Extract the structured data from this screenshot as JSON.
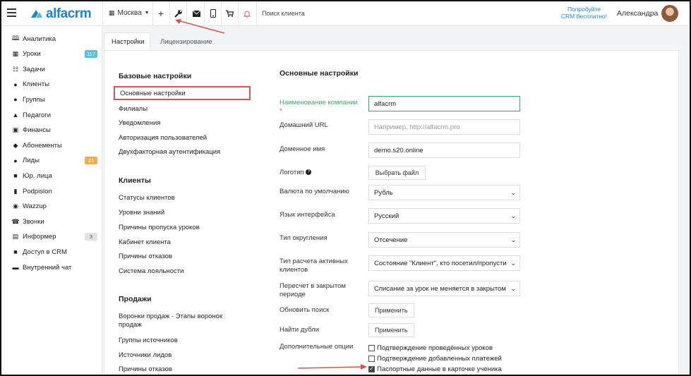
{
  "topbar": {
    "logo_text": "alfacrm",
    "city": "Москва",
    "search_placeholder": "Поиск клиента",
    "promo_line1": "Попробуйте",
    "promo_line2": "CRM бесплатно!",
    "user_name": "Александра",
    "icons": [
      "menu-icon",
      "chevron-down-icon",
      "plus-icon",
      "wrench-icon",
      "mail-icon",
      "phone-icon",
      "cart-icon",
      "bell-icon"
    ]
  },
  "sidebar": {
    "items": [
      {
        "label": "Аналитика",
        "icon": "book-icon"
      },
      {
        "label": "Уроки",
        "icon": "calendar-icon",
        "badge": "117",
        "badge_color": "#5bc0de"
      },
      {
        "label": "Задачи",
        "icon": "clipboard-icon"
      },
      {
        "label": "Клиенты",
        "icon": "user-icon"
      },
      {
        "label": "Группы",
        "icon": "users-icon"
      },
      {
        "label": "Педагоги",
        "icon": "graduation-cap-icon"
      },
      {
        "label": "Финансы",
        "icon": "money-icon"
      },
      {
        "label": "Абонементы",
        "icon": "ticket-icon"
      },
      {
        "label": "Лиды",
        "icon": "user-plus-icon",
        "badge": "21",
        "badge_color": "#f0ad4e"
      },
      {
        "label": "Юр. лица",
        "icon": "briefcase-icon"
      },
      {
        "label": "Podpislon",
        "icon": "document-icon"
      },
      {
        "label": "Wazzup",
        "icon": "whatsapp-icon"
      },
      {
        "label": "Звонки",
        "icon": "phone-icon"
      },
      {
        "label": "Информер",
        "icon": "server-icon",
        "badge": "3",
        "badge_color": "#dfe3e6"
      },
      {
        "label": "Доступ в CRM",
        "icon": "lock-icon"
      },
      {
        "label": "Внутренний чат",
        "icon": "chat-icon"
      }
    ]
  },
  "tabs": [
    {
      "label": "Настройки",
      "active": true
    },
    {
      "label": "Лицензирование",
      "active": false
    }
  ],
  "settings_nav": {
    "sections": [
      {
        "heading": "Базовые настройки",
        "links": [
          "Основные настройки",
          "Филиалы",
          "Уведомления",
          "Авторизация пользователей",
          "Двухфакторная аутентификация"
        ]
      },
      {
        "heading": "Клиенты",
        "links": [
          "Статусы клиентов",
          "Уровни знаний",
          "Причины пропуска уроков",
          "Кабинет клиента",
          "Причины отказов",
          "Система лояльности"
        ]
      },
      {
        "heading": "Продажи",
        "links": [
          "Воронки продаж - Этапы воронок продаж",
          "Группы источников",
          "Источники лидов",
          "Причины отказов"
        ]
      }
    ]
  },
  "form": {
    "title": "Основные настройки",
    "company_label": "Наименование компании",
    "company_value": "alfacrm",
    "home_url_label": "Домашний URL",
    "home_url_placeholder": "Например, http://alfacrm.pro",
    "domain_label": "Доменное имя",
    "domain_value": "demo.s20.online",
    "logo_label": "Логотип",
    "logo_button": "Выбрать файл",
    "currency_label": "Валюта по умолчанию",
    "currency_value": "Рубль",
    "language_label": "Язык интерфейса",
    "language_value": "Русский",
    "rounding_label": "Тип округления",
    "rounding_value": "Отсечение",
    "active_calc_label": "Тип расчета активных клиентов",
    "active_calc_value": "Состояние \"Клиент\", кто посетил/пропусти",
    "recalc_label": "Пересчет в закрытом периоде",
    "recalc_value": "Списание за урок не меняется в закрытом",
    "refresh_search_label": "Обновить поиск",
    "refresh_search_button": "Применить",
    "find_dupes_label": "Найти дубли",
    "find_dupes_button": "Применить",
    "extra_options_label": "Дополнительные опции",
    "options": [
      {
        "label": "Подтверждение проведённых уроков",
        "checked": false
      },
      {
        "label": "Подтверждение добавленных платежей",
        "checked": false
      },
      {
        "label": "Паспортные данные в карточке ученика",
        "checked": true
      }
    ]
  },
  "colors": {
    "brand": "#1a86c9",
    "required_label": "#3aa76d",
    "highlight": "#d9534f"
  }
}
